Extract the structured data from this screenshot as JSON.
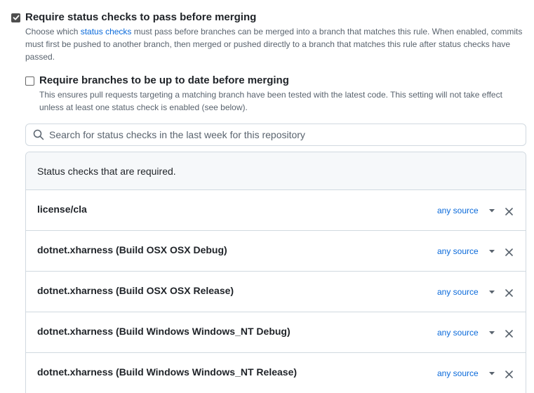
{
  "require_status_checks": {
    "checked": true,
    "label": "Require status checks to pass before merging",
    "desc_before": "Choose which ",
    "desc_link": "status checks",
    "desc_after": " must pass before branches can be merged into a branch that matches this rule. When enabled, commits must first be pushed to another branch, then merged or pushed directly to a branch that matches this rule after status checks have passed."
  },
  "require_up_to_date": {
    "checked": false,
    "label": "Require branches to be up to date before merging",
    "desc": "This ensures pull requests targeting a matching branch have been tested with the latest code. This setting will not take effect unless at least one status check is enabled (see below)."
  },
  "search": {
    "placeholder": "Search for status checks in the last week for this repository",
    "value": ""
  },
  "status_checks": {
    "header": "Status checks that are required.",
    "items": [
      {
        "name": "license/cla",
        "source": "any source"
      },
      {
        "name": "dotnet.xharness (Build OSX OSX Debug)",
        "source": "any source"
      },
      {
        "name": "dotnet.xharness (Build OSX OSX Release)",
        "source": "any source"
      },
      {
        "name": "dotnet.xharness (Build Windows Windows_NT Debug)",
        "source": "any source"
      },
      {
        "name": "dotnet.xharness (Build Windows Windows_NT Release)",
        "source": "any source"
      }
    ]
  },
  "icons": {
    "search": "search-icon",
    "checkmark": "checkmark-icon",
    "caret": "triangle-down-icon",
    "remove": "x-icon"
  },
  "colors": {
    "link": "#0969da",
    "border": "#d1d9e0",
    "header_bg": "#f6f8fa",
    "muted_text": "#59636e",
    "checkbox_checked": "#4e4e4e"
  }
}
